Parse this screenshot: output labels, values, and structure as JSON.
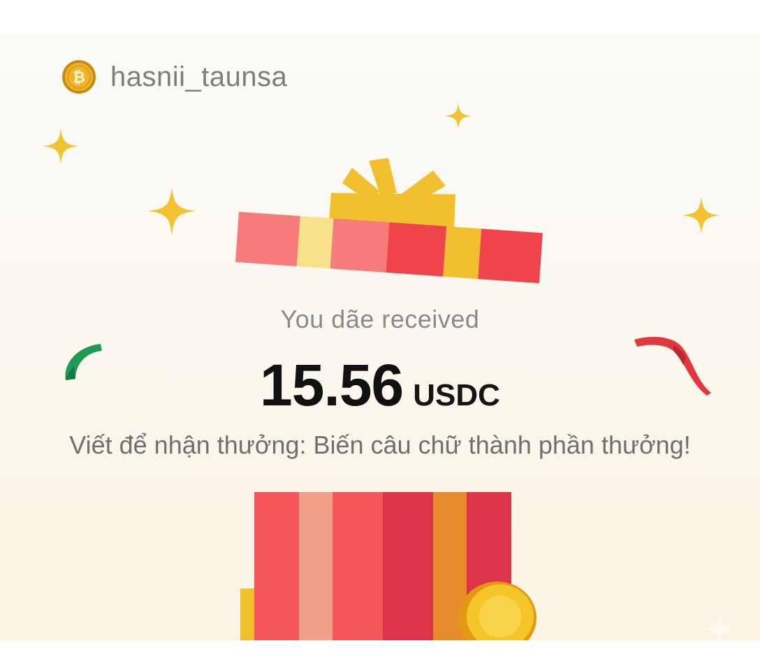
{
  "header": {
    "username": "hasnii_taunsa",
    "coin_icon": "bitcoin-coin-icon"
  },
  "reward": {
    "received_label": "You dãe received",
    "amount": "15.56",
    "currency": "USDC",
    "prompt": "Viết để nhận thưởng: Biến câu chữ thành phần thưởng!"
  },
  "decorations": {
    "sparkle_icon": "sparkle-icon",
    "gift_lid": "gift-lid-icon",
    "gift_box": "gift-box-icon",
    "gold_coin": "gold-coin-icon",
    "colors": {
      "sparkle": "#f2c230",
      "gift_red": "#f0444d",
      "gift_pink": "#f77b7b",
      "gift_gold": "#f2bf2f",
      "gift_cream": "#f6e08a",
      "ribbon_green": "#1f9a55",
      "ribbon_red": "#e0383e"
    }
  }
}
